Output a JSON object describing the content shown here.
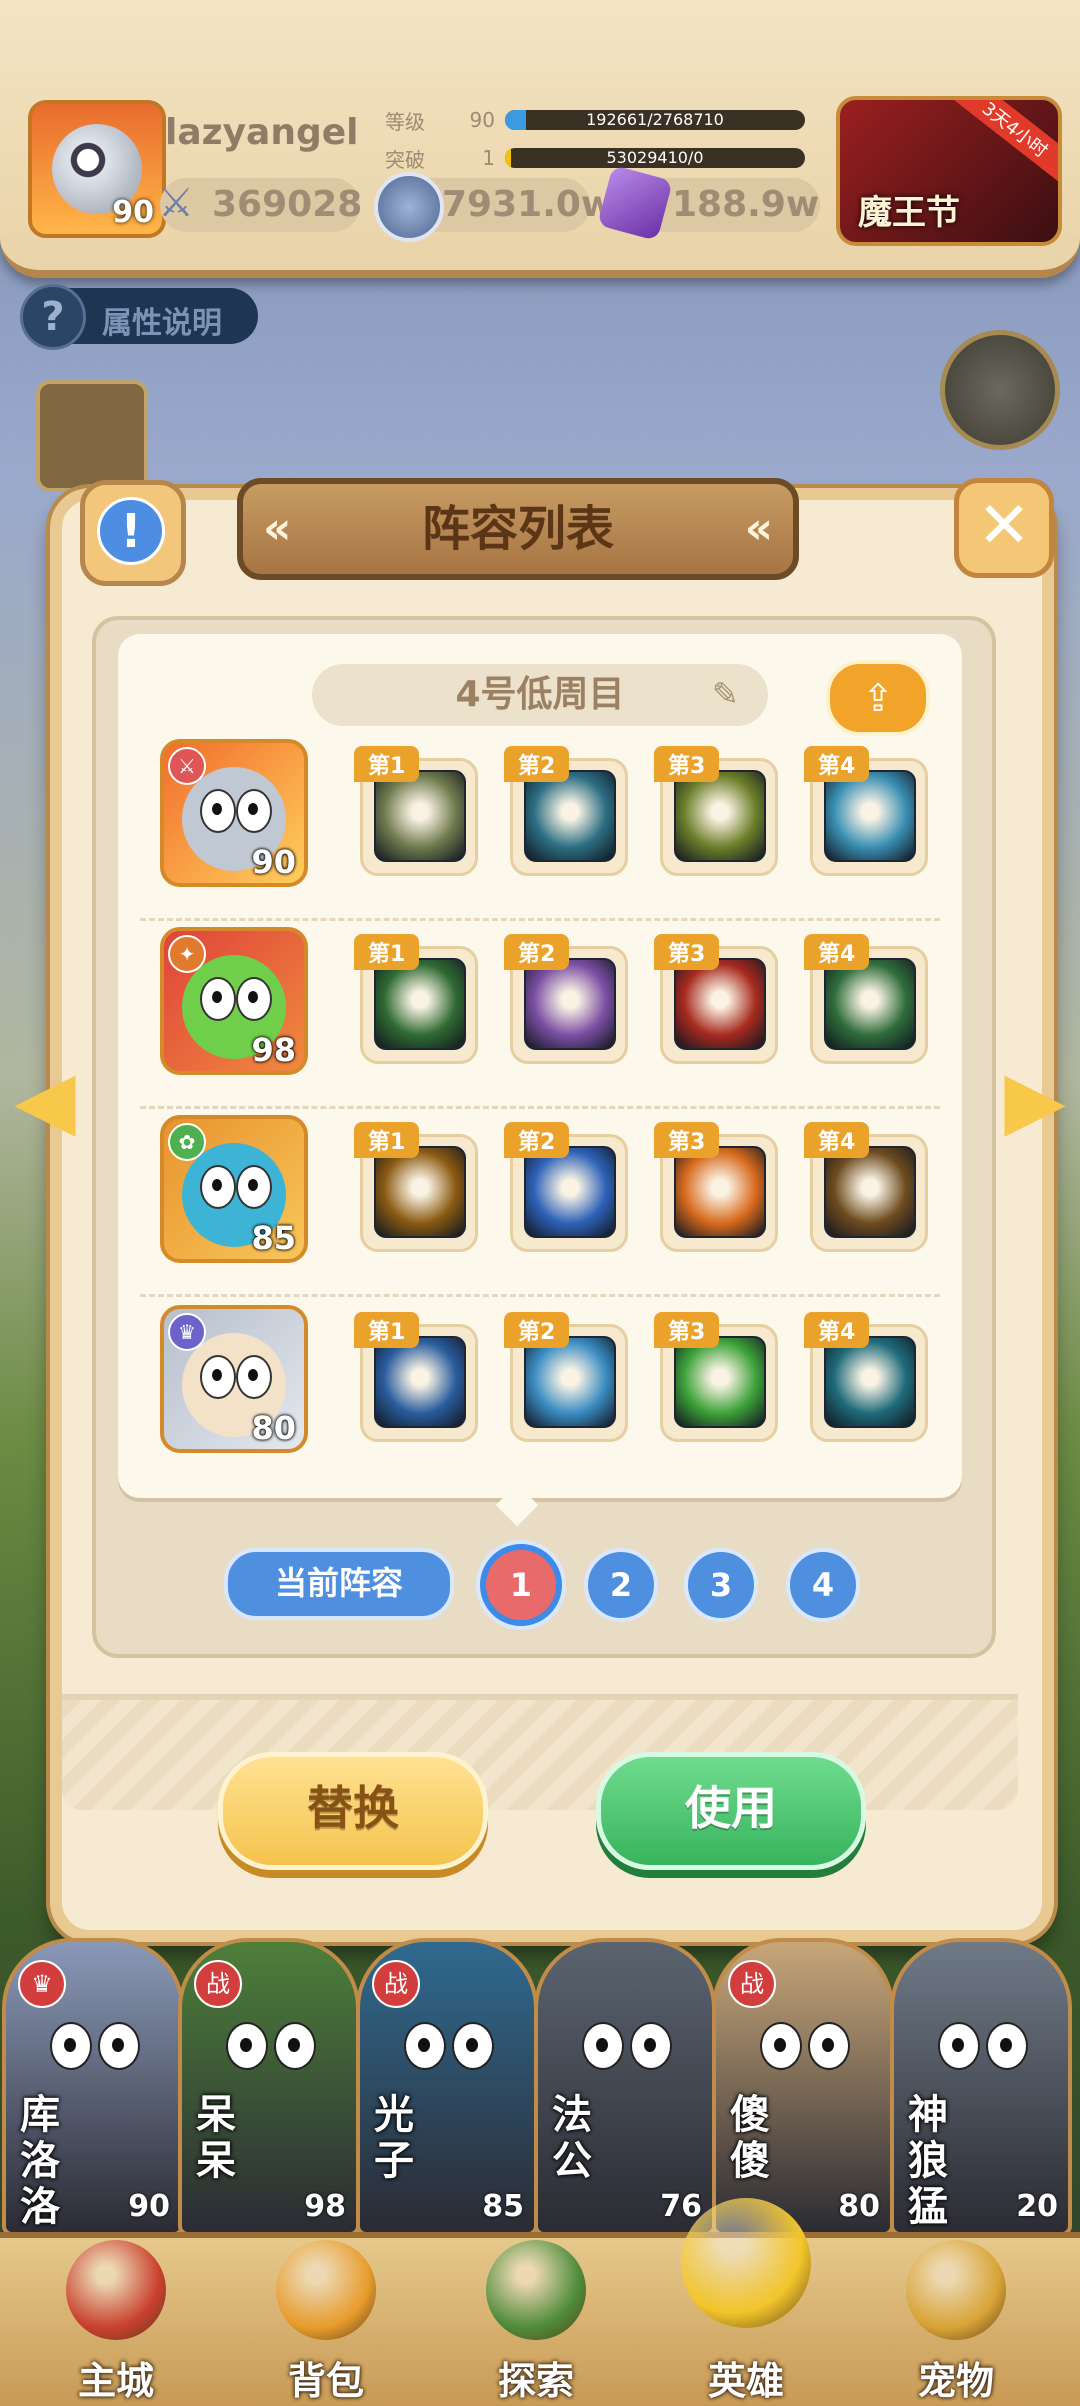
{
  "player": {
    "name": "lazyangel",
    "avatar_level": "90",
    "power": "369028",
    "level_label": "等级",
    "level": "90",
    "exp_text": "192661/2768710",
    "exp_fraction": 0.07,
    "break_label": "突破",
    "break_level": "1",
    "break_text": "53029410/0",
    "break_fraction": 0.02,
    "coins": "7931.0w",
    "gems": "188.9w"
  },
  "event": {
    "title": "魔王节",
    "ribbon": "3天4小时"
  },
  "attr_help": "属性说明",
  "dialog": {
    "title": "阵容列表",
    "lineup_name": "4号低周目",
    "current_label": "当前阵容",
    "pages": [
      "1",
      "2",
      "3",
      "4"
    ],
    "active_page": "1",
    "replace_button": "替换",
    "use_button": "使用",
    "slot_labels": [
      "第1",
      "第2",
      "第3",
      "第4"
    ]
  },
  "lineup": [
    {
      "hero": "knight-duck",
      "level": "90",
      "skills": [
        "sword-strike-icon",
        "shadow-wolf-icon",
        "golden-shield-icon",
        "steel-hammer-icon"
      ]
    },
    {
      "hero": "green-orc",
      "level": "98",
      "skills": [
        "dark-fist-icon",
        "purple-ghost-icon",
        "fire-demon-icon",
        "green-blade-icon"
      ]
    },
    {
      "hero": "blue-fish-warrior",
      "level": "85",
      "skills": [
        "star-burst-icon",
        "blue-spirit-icon",
        "flame-spear-icon",
        "target-crosshair-icon"
      ]
    },
    {
      "hero": "crowned-egg",
      "level": "80",
      "skills": [
        "ice-blade-icon",
        "water-trident-icon",
        "green-cloud-icon",
        "red-mask-icon"
      ]
    }
  ],
  "hero_bar": [
    {
      "name": "库洛洛",
      "level": "90",
      "badge": "♛"
    },
    {
      "name": "呆呆",
      "level": "98",
      "badge": "战"
    },
    {
      "name": "光子",
      "level": "85",
      "badge": "战"
    },
    {
      "name": "法公",
      "level": "76",
      "badge": ""
    },
    {
      "name": "傻傻",
      "level": "80",
      "badge": "战"
    },
    {
      "name": "神狼猛",
      "level": "20",
      "badge": ""
    }
  ],
  "nav": [
    {
      "label": "主城"
    },
    {
      "label": "背包"
    },
    {
      "label": "探索"
    },
    {
      "label": "英雄"
    },
    {
      "label": "宠物"
    }
  ],
  "colors": {
    "accent_blue": "#4f8fe0",
    "accent_green": "#38b45e",
    "accent_yellow": "#f5c34d",
    "tag_orange": "#eba22b"
  }
}
